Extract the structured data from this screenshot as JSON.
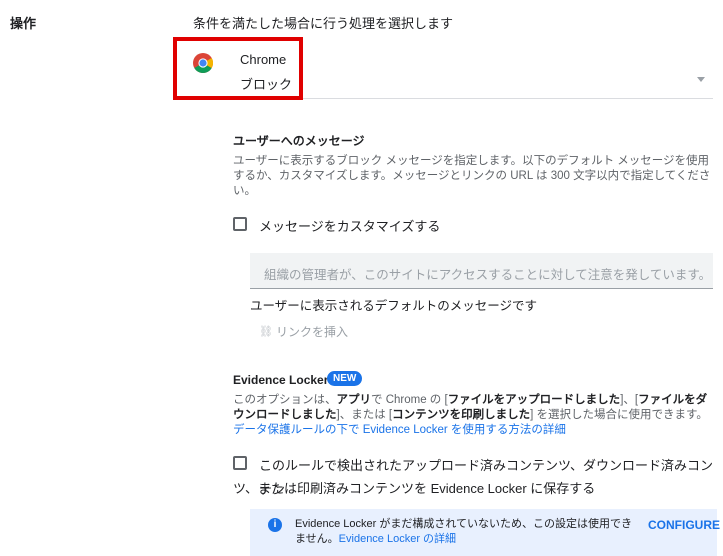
{
  "section": {
    "label": "操作",
    "description": "条件を満たした場合に行う処理を選択します"
  },
  "app": {
    "name": "Chrome",
    "action": "ブロック",
    "icon": "chrome-icon"
  },
  "colors": {
    "accent": "#1a73e8",
    "highlight_border": "#e00000",
    "info_bg": "#e8f0fe"
  },
  "user_message": {
    "heading": "ユーザーへのメッセージ",
    "description": "ユーザーに表示するブロック メッセージを指定します。以下のデフォルト メッセージを使用するか、カスタマイズします。メッセージとリンクの URL は 300 文字以内で指定してください。",
    "customize_label": "メッセージをカスタマイズする",
    "customize_checked": false,
    "message_placeholder": "組織の管理者が、このサイトにアクセスすることに対して注意を発しています。",
    "default_note": "ユーザーに表示されるデフォルトのメッセージです",
    "insert_link": "リンクを挿入",
    "insert_link_icon": "link-icon"
  },
  "evidence_locker": {
    "heading": "Evidence Locker",
    "badge": "NEW",
    "desc_part1": "このオプションは、",
    "desc_bold1": "アプリ",
    "desc_part2": "で Chrome の [",
    "desc_bold2": "ファイルをアップロードしました",
    "desc_part3": "]、[",
    "desc_bold3": "ファイルをダウンロードしました",
    "desc_part4": "]、または [",
    "desc_bold4": "コンテンツを印刷しました",
    "desc_part5": "] を選択した場合に使用できます。",
    "desc_link": "データ保護ルールの下で Evidence Locker を使用する方法の詳細",
    "checkbox_label_line1": "このルールで検出されたアップロード済みコンテンツ、ダウンロード済みコンテン",
    "checkbox_label_line2": "ツ、または印刷済みコンテンツを Evidence Locker に保存する",
    "checkbox_checked": false,
    "info_text": "Evidence Locker がまだ構成されていないため、この設定は使用できません。",
    "info_link": "Evidence Locker の詳細",
    "info_icon": "info-icon",
    "configure_label": "CONFIGURE"
  }
}
